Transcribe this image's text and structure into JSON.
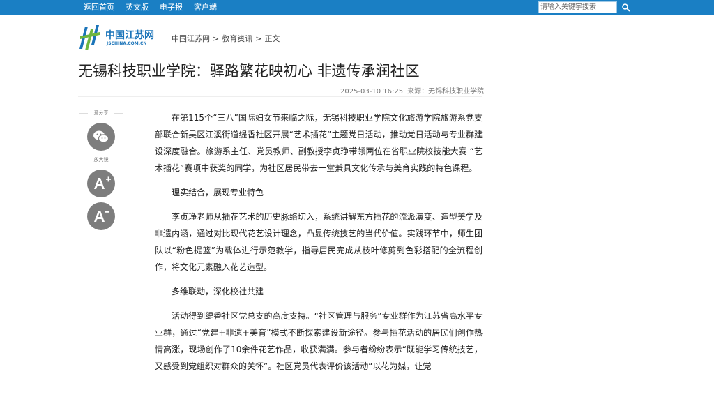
{
  "topbar": {
    "links": [
      "返回首页",
      "英文版",
      "电子报",
      "客户端"
    ],
    "search_placeholder": "请输入关键字搜索",
    "search_icon": "search-icon",
    "bg_color": "#1a7fc4"
  },
  "logo": {
    "name": "中国江苏网",
    "domain": "JSCHINA.COM.CN"
  },
  "breadcrumb": {
    "items": [
      "中国江苏网",
      "教育资讯",
      "正文"
    ],
    "separator": ">"
  },
  "article": {
    "title": "无锡科技职业学院：驿路繁花映初心 非遗传承润社区",
    "date": "2025-03-10 16:25",
    "source": "来源：无锡科技职业学院",
    "paragraphs": [
      "在第115个“三八”国际妇女节来临之际，无锡科技职业学院文化旅游学院旅游系党支部联合新吴区江溪街道缇香社区开展“艺术插花”主题党日活动，推动党日活动与专业群建设深度融合。旅游系主任、党员教师、副教授李贞琤带领两位在省职业院校技能大赛 “艺术插花”赛项中获奖的同学，为社区居民带去一堂兼具文化传承与美育实践的特色课程。",
      "理实结合，展现专业特色",
      "李贞琤老师从插花艺术的历史脉络切入，系统讲解东方插花的流派演变、造型美学及非遗内涵，通过对比现代花艺设计理念，凸显传统技艺的当代价值。实践环节中，师生团队以“粉色提篮”为载体进行示范教学，指导居民完成从枝叶修剪到色彩搭配的全流程创作，将文化元素融入花艺造型。",
      "多维联动，深化校社共建",
      "活动得到缇香社区党总支的高度支持。“社区管理与服务”专业群作为江苏省高水平专业群，通过“党建+非遗+美育”模式不断探索建设新途径。参与插花活动的居民们创作热情高涨，现场创作了10余件花艺作品，收获满满。参与者纷纷表示“既能学习传统技艺，又感受到党组织对群众的关怀”。社区党员代表评价该活动“以花为媒，让党"
    ]
  },
  "side": {
    "share_label": "爱分享",
    "zoom_label": "放大镜",
    "wechat_icon": "wechat-icon",
    "zoom_in_icon": "font-increase-icon",
    "zoom_out_icon": "font-decrease-icon"
  }
}
